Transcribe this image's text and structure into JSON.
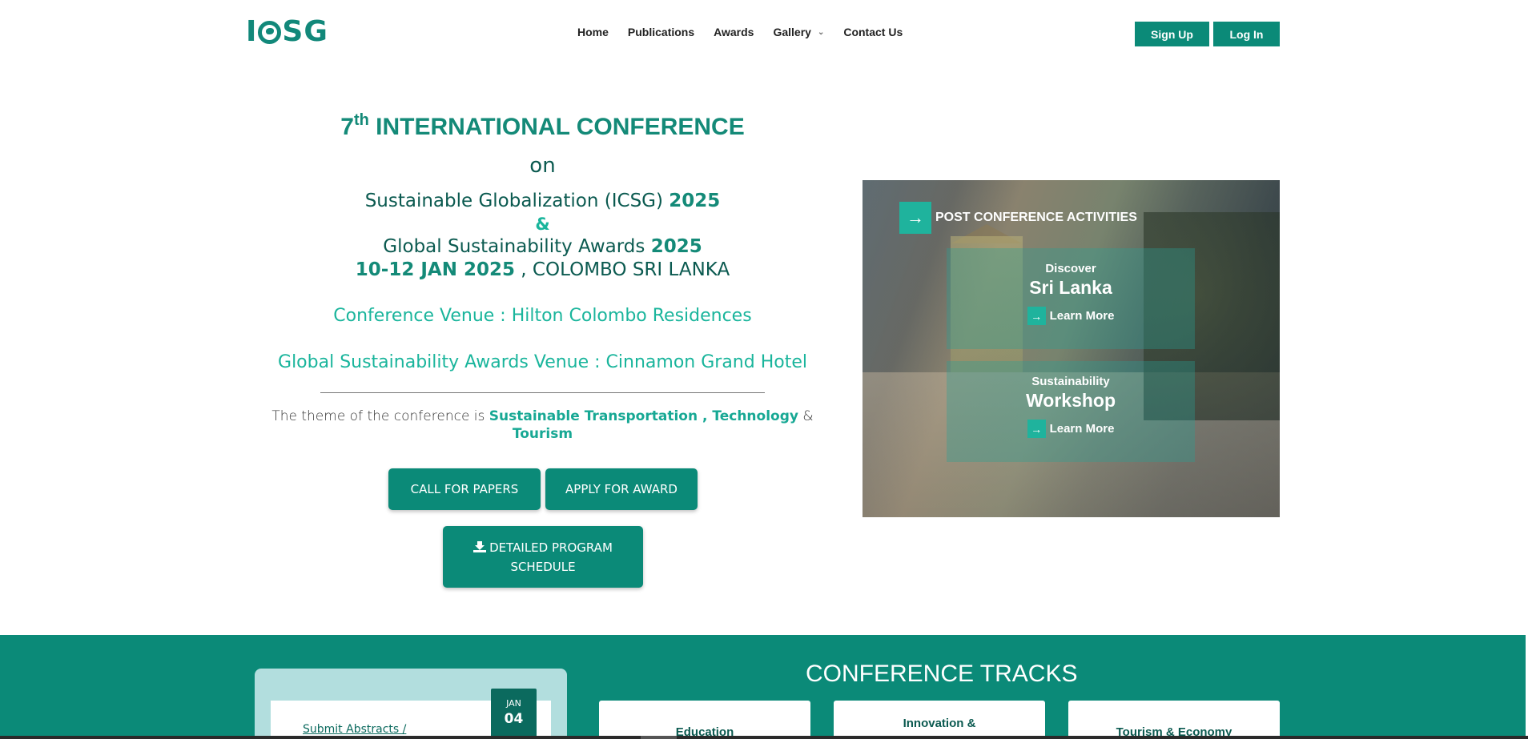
{
  "header": {
    "logo_text": "ICSG",
    "nav": [
      {
        "label": "Home"
      },
      {
        "label": "Publications"
      },
      {
        "label": "Awards"
      },
      {
        "label": "Gallery"
      },
      {
        "label": "Contact Us"
      }
    ],
    "signup_label": "Sign Up",
    "login_label": "Log In"
  },
  "hero": {
    "ordinal": "7",
    "ordinal_suffix": "th",
    "title_rest": "INTERNATIONAL CONFERENCE",
    "on": "on",
    "line1_text": "Sustainable Globalization (ICSG) ",
    "line1_year": "2025",
    "amp": "&",
    "line2_text": "Global Sustainability Awards ",
    "line2_year": "2025",
    "dates": "10-12 JAN 2025",
    "location": " , COLOMBO SRI LANKA",
    "venue1": "Conference Venue : Hilton Colombo Residences",
    "venue2": "Global Sustainability Awards Venue : Cinnamon Grand Hotel",
    "theme_prefix": "The theme of the conference is ",
    "theme_1": "Sustainable Transportation",
    "theme_sep": " , ",
    "theme_2": "Technology",
    "theme_amp": " & ",
    "theme_3": "Tourism",
    "btn_call": "CALL FOR PAPERS",
    "btn_award": "APPLY FOR AWARD",
    "btn_schedule_1": "DETAILED PROGRAM",
    "btn_schedule_2": "SCHEDULE"
  },
  "panel": {
    "title": "POST CONFERENCE ACTIVITIES",
    "cards": [
      {
        "kicker": "Discover",
        "big": "Sri Lanka",
        "more": "Learn More"
      },
      {
        "kicker": "Sustainability",
        "big": "Workshop",
        "more": "Learn More"
      }
    ]
  },
  "band": {
    "date_link": "Submit Abstracts /",
    "date_month": "JAN",
    "date_day": "04",
    "tracks_title": "CONFERENCE TRACKS",
    "tracks": [
      "Education",
      "Innovation &",
      "Tourism & Economy"
    ]
  },
  "colors": {
    "brand": "#0b8a78",
    "accent": "#1ab59c",
    "dark_text": "#0b5a50"
  }
}
